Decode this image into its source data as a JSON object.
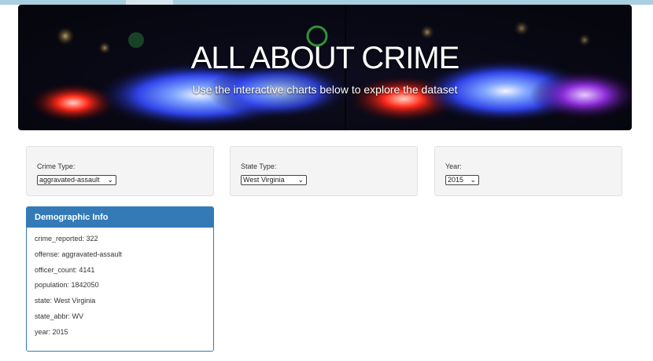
{
  "hero": {
    "title": "ALL ABOUT CRIME",
    "subtitle": "Use the interactive charts below to explore the dataset"
  },
  "filters": {
    "crime": {
      "label": "Crime Type:",
      "selected": "aggravated-assault"
    },
    "state": {
      "label": "State Type:",
      "selected": "West Virginia"
    },
    "year": {
      "label": "Year:",
      "selected": "2015"
    }
  },
  "demographic": {
    "heading": "Demographic Info",
    "rows": [
      "crime_reported: 322",
      "offense: aggravated-assault",
      "officer_count: 4141",
      "population: 1842050",
      "state: West Virginia",
      "state_abbr: WV",
      "year: 2015"
    ]
  },
  "colors": {
    "panel_accent": "#337ab7",
    "filter_bg": "#f4f4f4"
  },
  "icons": [
    "chevron-down-icon"
  ]
}
